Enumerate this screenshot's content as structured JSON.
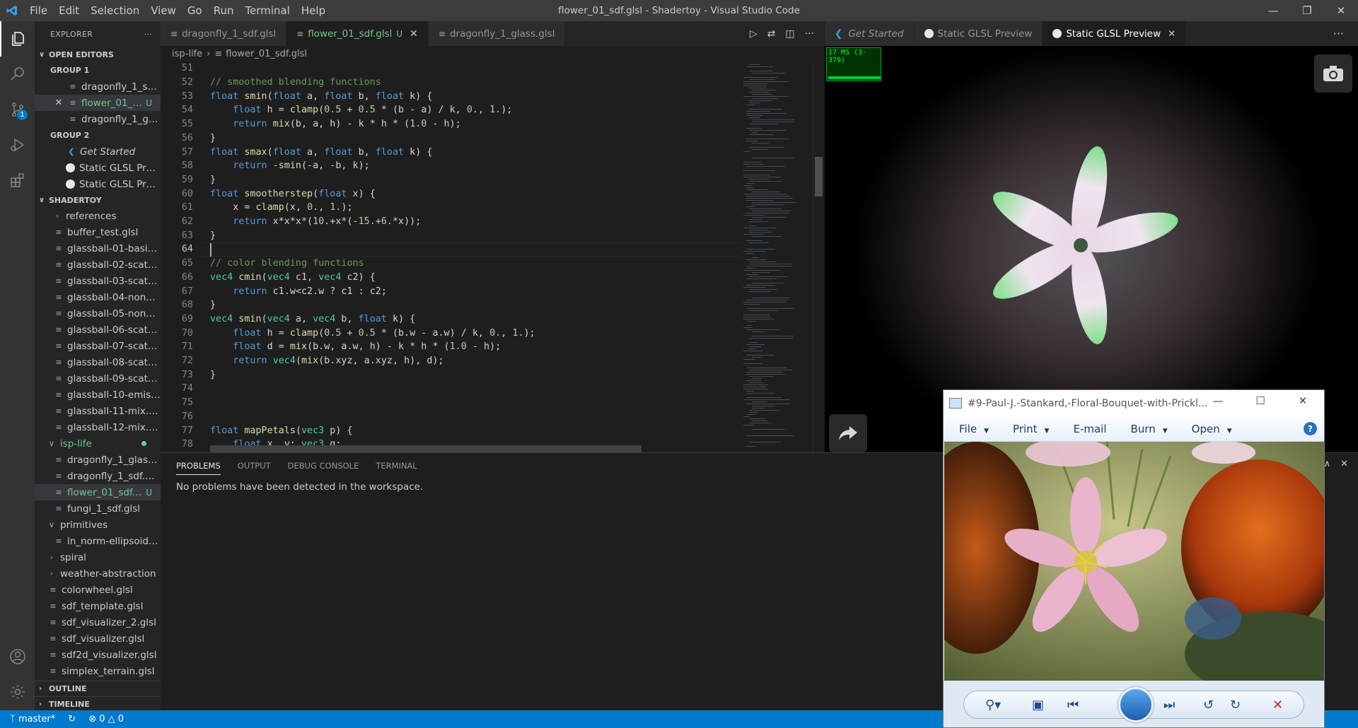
{
  "window": {
    "title": "flower_01_sdf.glsl - Shadertoy - Visual Studio Code",
    "menu": [
      "File",
      "Edit",
      "Selection",
      "View",
      "Go",
      "Run",
      "Terminal",
      "Help"
    ]
  },
  "sidebar": {
    "header": "EXPLORER",
    "open_editors": "OPEN EDITORS",
    "group1": "GROUP 1",
    "group1_items": [
      "dragonfly_1_sdf....",
      "flower_01_s...",
      "dragonfly_1_glas..."
    ],
    "group1_flag": "U",
    "group2": "GROUP 2",
    "group2_items": [
      "Get Started",
      "Static GLSL Previ...",
      "Static GLSL Previ..."
    ],
    "shadertoy": "SHADERTOY",
    "files": [
      "references",
      "buffer_test.glsl",
      "glassball-01-basic.glsl",
      "glassball-02-scatter....",
      "glassball-03-scatter....",
      "glassball-04-nonunif...",
      "glassball-05-nonunif...",
      "glassball-06-scatter_...",
      "glassball-07-scatter....",
      "glassball-08-scatter....",
      "glassball-09-scatter....",
      "glassball-10-emissio...",
      "glassball-11-mix.glsl",
      "glassball-12-mix.glsl",
      "isp-life",
      "dragonfly_1_glass.glsl",
      "dragonfly_1_sdf.glsl",
      "flower_01_sdf.g...",
      "fungi_1_sdf.glsl",
      "primitives",
      "ln_norm-ellipsoid.glsl",
      "spiral",
      "weather-abstraction",
      "colorwheel.glsl",
      "sdf_template.glsl",
      "sdf_visualizer_2.glsl",
      "sdf_visualizer.glsl",
      "sdf2d_visualizer.glsl",
      "simplex_terrain.glsl"
    ],
    "outline": "OUTLINE",
    "timeline": "TIMELINE"
  },
  "editor": {
    "tabs": [
      "dragonfly_1_sdf.glsl",
      "flower_01_sdf.glsl",
      "dragonfly_1_glass.glsl"
    ],
    "active_flag": "U",
    "breadcrumb": [
      "isp-life",
      "flower_01_sdf.glsl"
    ],
    "line_numbers": [
      "51",
      "52",
      "53",
      "54",
      "55",
      "56",
      "57",
      "58",
      "59",
      "60",
      "61",
      "62",
      "63",
      "64",
      "65",
      "66",
      "67",
      "68",
      "69",
      "70",
      "71",
      "72",
      "73",
      "74",
      "75",
      "76",
      "77",
      "78"
    ]
  },
  "preview": {
    "tabs": [
      "Get Started",
      "Static GLSL Preview",
      "Static GLSL Preview"
    ],
    "fps": "17 MS (3-379)"
  },
  "panel": {
    "tabs": [
      "PROBLEMS",
      "OUTPUT",
      "DEBUG CONSOLE",
      "TERMINAL"
    ],
    "message": "No problems have been detected in the workspace."
  },
  "status": {
    "branch": "master*",
    "errors": "0",
    "warnings": "0"
  },
  "viewer": {
    "title": "#9-Paul-J.-Stankard,-Floral-Bouquet-with-Prickl...",
    "menu": [
      "File",
      "Print",
      "E-mail",
      "Burn",
      "Open"
    ],
    "help": "?"
  },
  "colors": {
    "accent": "#007acc",
    "modified": "#73c991",
    "activity_bar": "#333333",
    "sidebar": "#252526",
    "editor_bg": "#1e1e1e"
  }
}
